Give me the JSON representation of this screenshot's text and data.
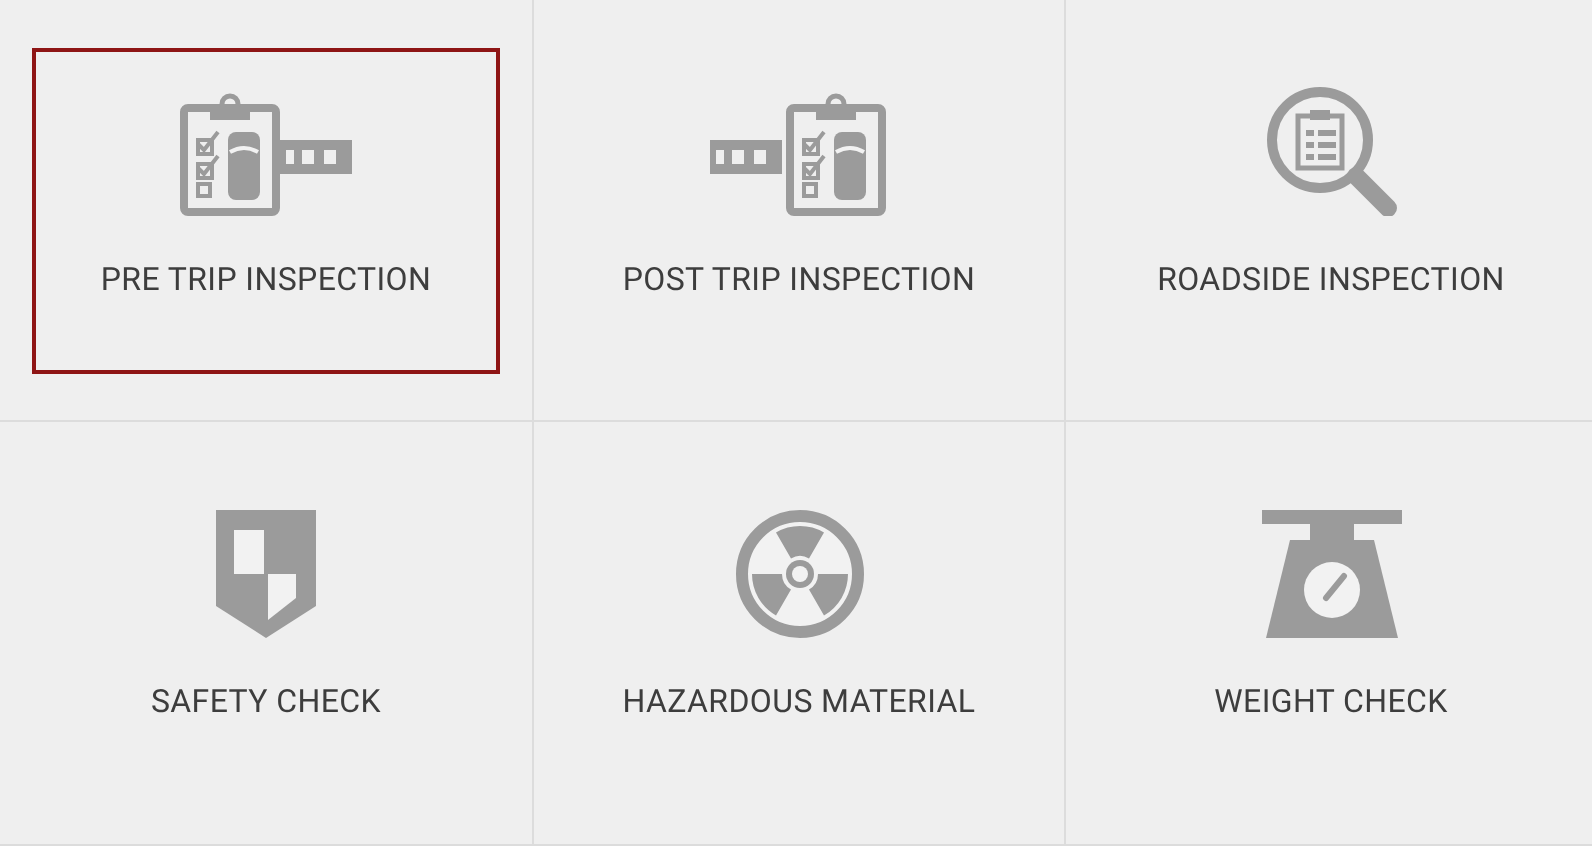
{
  "tiles": [
    {
      "label": "PRE TRIP INSPECTION",
      "kind": "pretrip",
      "selected": true
    },
    {
      "label": "POST TRIP INSPECTION",
      "kind": "posttrip",
      "selected": false
    },
    {
      "label": "ROADSIDE INSPECTION",
      "kind": "roadside",
      "selected": false
    },
    {
      "label": "SAFETY CHECK",
      "kind": "safety",
      "selected": false
    },
    {
      "label": "HAZARDOUS MATERIAL",
      "kind": "hazmat",
      "selected": false
    },
    {
      "label": "WEIGHT CHECK",
      "kind": "weight",
      "selected": false
    }
  ]
}
